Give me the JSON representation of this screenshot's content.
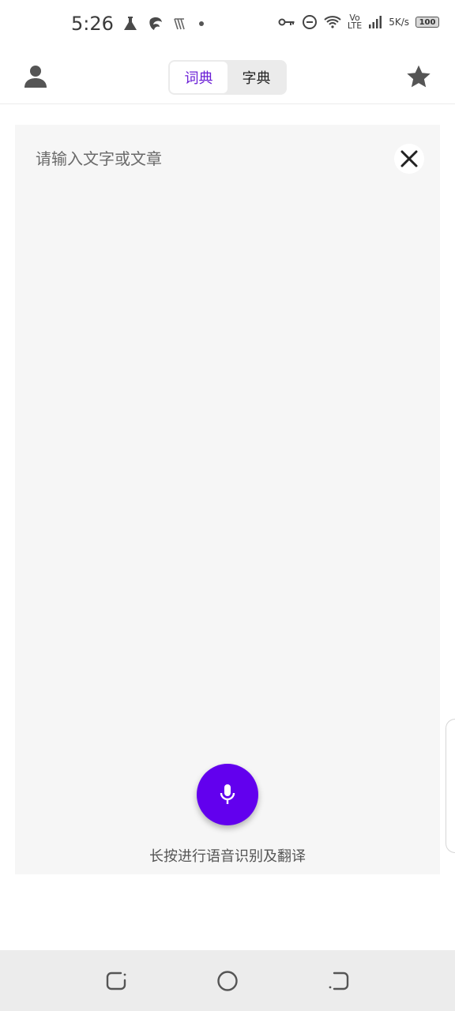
{
  "status_bar": {
    "time": "5:26",
    "volte_top": "Vo",
    "volte_bottom": "LTE",
    "speed_value": "5",
    "speed_unit": "K/s",
    "battery": "100"
  },
  "app_bar": {
    "toggle": [
      {
        "label": "词典",
        "active": true
      },
      {
        "label": "字典",
        "active": false
      }
    ]
  },
  "input": {
    "placeholder": "请输入文字或文章",
    "value": ""
  },
  "voice_hint": "长按进行语音识别及翻译",
  "colors": {
    "accent": "#6200ee",
    "active_tab_text": "#6b1fd6",
    "panel_bg": "#f6f6f6",
    "nav_bar_bg": "#ececec"
  },
  "icons": {
    "profile": "person-icon",
    "favorites": "star-icon",
    "clear": "close-icon",
    "mic": "microphone-icon",
    "nav_back": "back-icon",
    "nav_home": "home-icon",
    "nav_recents": "recents-icon"
  }
}
